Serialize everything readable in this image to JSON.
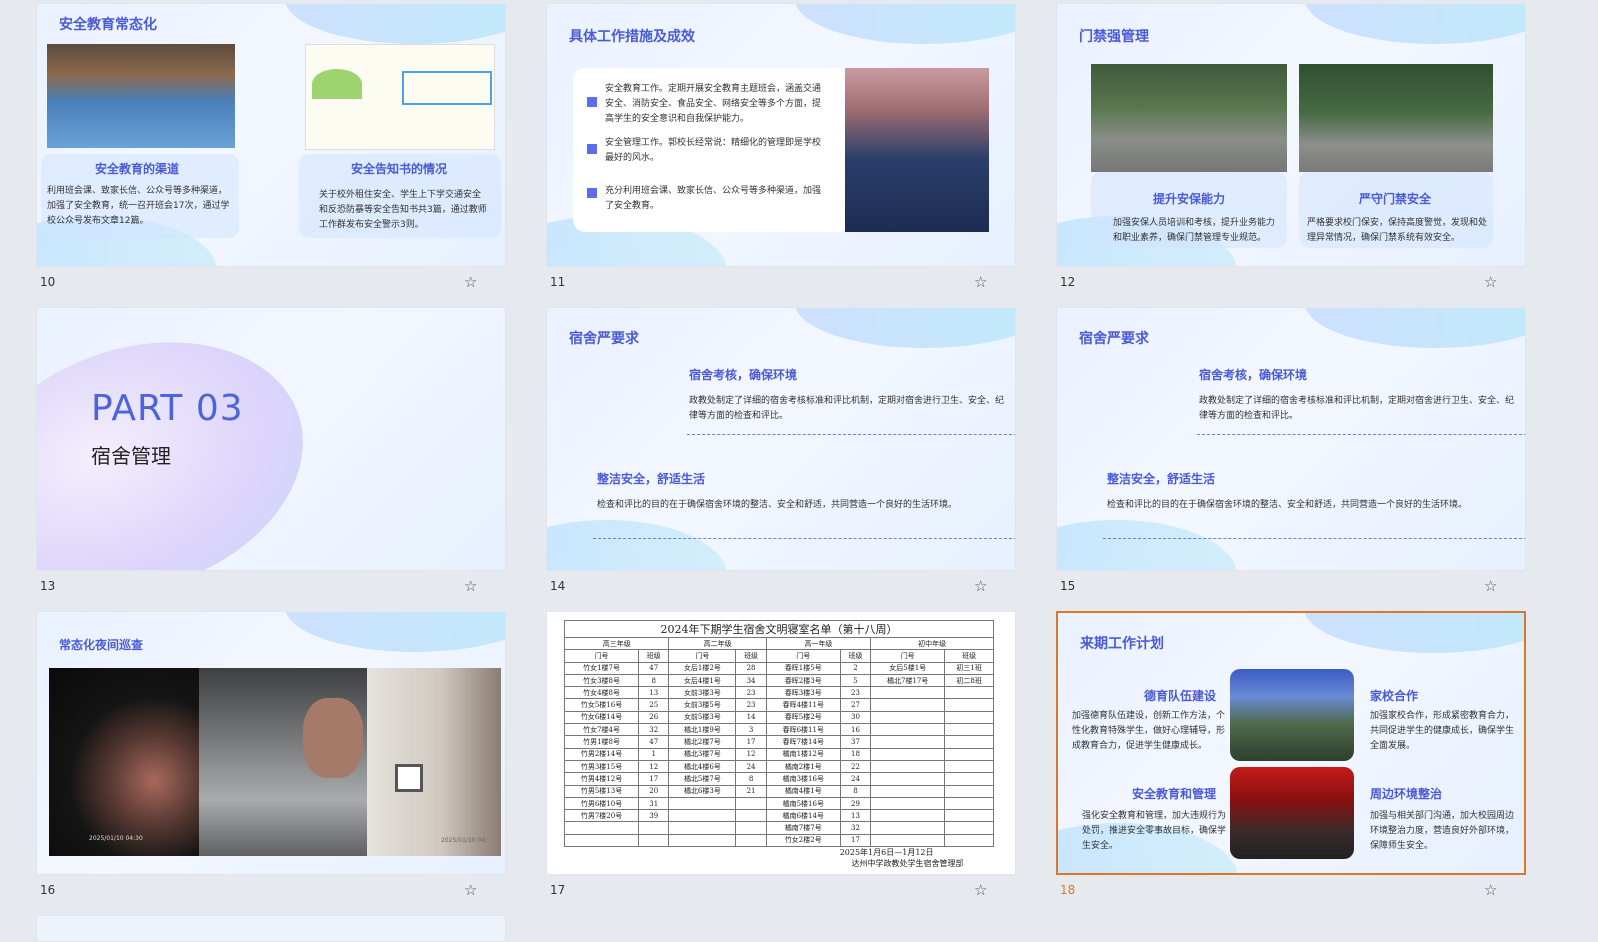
{
  "slides": [
    {
      "number": "10",
      "title": "安全教育常态化",
      "left_heading": "安全教育的渠道",
      "left_text": "利用班会课、致家长信、公众号等多种渠道，加强了安全教育，统一召开班会17次，通过学校公众号发布文章12篇。",
      "right_heading": "安全告知书的情况",
      "right_text": "关于校外租住安全、学生上下学交通安全和反恐防暴等安全告知书共3篇，通过教师工作群发布安全警示3则。"
    },
    {
      "number": "11",
      "title": "具体工作措施及成效",
      "bullets": [
        "安全教育工作。定期开展安全教育主题班会，涵盖交通安全、消防安全、食品安全、网络安全等多个方面，提高学生的安全意识和自我保护能力。",
        "安全管理工作。郭校长经常说：精细化的管理即是学校最好的风水。",
        "充分利用班会课、致家长信、公众号等多种渠道，加强了安全教育。"
      ]
    },
    {
      "number": "12",
      "title": "门禁强管理",
      "left_heading": "提升安保能力",
      "left_text": "加强安保人员培训和考核，提升业务能力和职业素养，确保门禁管理专业规范。",
      "right_heading": "严守门禁安全",
      "right_text": "严格要求校门保安，保持高度警觉，发现和处理异常情况，确保门禁系统有效安全。"
    },
    {
      "number": "13",
      "part": "PART 03",
      "subtitle": "宿舍管理"
    },
    {
      "number": "14",
      "title": "宿舍严要求",
      "h1": "宿舍考核，确保环境",
      "t1": "政教处制定了详细的宿舍考核标准和评比机制，定期对宿舍进行卫生、安全、纪律等方面的检查和评比。",
      "h2": "整洁安全，舒适生活",
      "t2": "检查和评比的目的在于确保宿舍环境的整洁、安全和舒适，共同营造一个良好的生活环境。"
    },
    {
      "number": "15",
      "title": "宿舍严要求",
      "h1": "宿舍考核，确保环境",
      "t1": "政教处制定了详细的宿舍考核标准和评比机制，定期对宿舍进行卫生、安全、纪律等方面的检查和评比。",
      "h2": "整洁安全，舒适生活",
      "t2": "检查和评比的目的在于确保宿舍环境的整洁、安全和舒适，共同营造一个良好的生活环境。"
    },
    {
      "number": "16",
      "title": "常态化夜间巡查",
      "stamp1": "2025/01/10 04:30",
      "stamp2": "2025/01/10 04:"
    },
    {
      "number": "17",
      "table": {
        "title": "2024年下期学生宿舍文明寝室名单（第十八周）",
        "groups": [
          "高三年级",
          "高二年级",
          "高一年级",
          "初中年级"
        ],
        "col_labels": [
          "门号",
          "班级"
        ],
        "rows": [
          [
            "竹女1楼7号",
            "47",
            "女后1楼2号",
            "28",
            "春晖1楼5号",
            "2",
            "女后5楼1号",
            "初三1班"
          ],
          [
            "竹女3楼8号",
            "8",
            "女后4楼1号",
            "34",
            "春晖2楼3号",
            "5",
            "橘北7楼17号",
            "初二8班"
          ],
          [
            "竹女4楼8号",
            "13",
            "女前3楼3号",
            "23",
            "春晖3楼3号",
            "23",
            "",
            ""
          ],
          [
            "竹女5楼16号",
            "25",
            "女前3楼5号",
            "23",
            "春晖4楼11号",
            "27",
            "",
            ""
          ],
          [
            "竹女6楼14号",
            "26",
            "女前5楼3号",
            "14",
            "春晖5楼2号",
            "30",
            "",
            ""
          ],
          [
            "竹女7楼4号",
            "32",
            "橘北1楼9号",
            "3",
            "春晖6楼11号",
            "16",
            "",
            ""
          ],
          [
            "竹男1楼8号",
            "47",
            "橘北2楼7号",
            "17",
            "春晖7楼14号",
            "37",
            "",
            ""
          ],
          [
            "竹男2楼14号",
            "1",
            "橘北3楼7号",
            "12",
            "橘南1楼12号",
            "18",
            "",
            ""
          ],
          [
            "竹男3楼15号",
            "12",
            "橘北4楼6号",
            "24",
            "橘南2楼1号",
            "22",
            "",
            ""
          ],
          [
            "竹男4楼12号",
            "17",
            "橘北5楼7号",
            "8",
            "橘南3楼16号",
            "24",
            "",
            ""
          ],
          [
            "竹男5楼13号",
            "20",
            "橘北6楼3号",
            "21",
            "橘南4楼1号",
            "8",
            "",
            ""
          ],
          [
            "竹男6楼10号",
            "31",
            "",
            "",
            "橘南5楼16号",
            "29",
            "",
            ""
          ],
          [
            "竹男7楼20号",
            "39",
            "",
            "",
            "橘南6楼14号",
            "13",
            "",
            ""
          ],
          [
            "",
            "",
            "",
            "",
            "橘南7楼7号",
            "32",
            "",
            ""
          ],
          [
            "",
            "",
            "",
            "",
            "竹女2楼2号",
            "17",
            "",
            ""
          ]
        ],
        "date": "2025年1月6日—1月12日",
        "footer": "达州中学政教处学生宿舍管理部"
      }
    },
    {
      "number": "18",
      "title": "来期工作计划",
      "items": [
        {
          "heading": "德育队伍建设",
          "text": "加强德育队伍建设，创新工作方法，个性化教育特殊学生，做好心理辅导，形成教育合力，促进学生健康成长。"
        },
        {
          "heading": "家校合作",
          "text": "加强家校合作，形成紧密教育合力，共同促进学生的健康成长，确保学生全面发展。"
        },
        {
          "heading": "安全教育和管理",
          "text": "强化安全教育和管理，加大违规行为处罚，推进安全零事故目标，确保学生安全。"
        },
        {
          "heading": "周边环境整治",
          "text": "加强与相关部门沟通，加大校园周边环境整治力度，营造良好外部环境，保障师生安全。"
        }
      ]
    }
  ],
  "star_glyph": "☆"
}
